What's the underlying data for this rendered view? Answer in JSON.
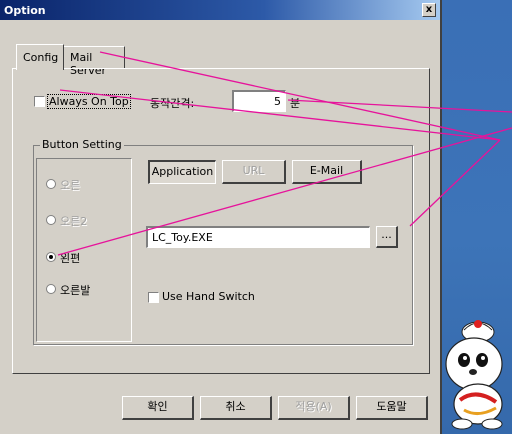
{
  "window": {
    "title": "Option",
    "close_label": "x"
  },
  "tabs": [
    {
      "label": "Config"
    },
    {
      "label": "Mail Server"
    }
  ],
  "config": {
    "always_on_top_label": "Always On Top",
    "interval_label": "동작간격:",
    "interval_value": "5",
    "interval_unit": "분"
  },
  "button_setting": {
    "title": "Button Setting",
    "radio_options": [
      "오른",
      "오른2",
      "왼편",
      "오른발"
    ],
    "selected_option": "왼편",
    "type_buttons": [
      "Application",
      "URL",
      "E-Mail"
    ],
    "path_value": "LC_Toy.EXE",
    "browse_label": "...",
    "hand_switch_label": "Use Hand Switch"
  },
  "footer": {
    "ok_label": "확인",
    "cancel_label": "취소",
    "apply_label": "적용(A)",
    "help_label": "도움말"
  },
  "colors": {
    "annotation": "#e6139b",
    "titlebar": "#0a246a",
    "desktop": "#3a6fb6"
  }
}
